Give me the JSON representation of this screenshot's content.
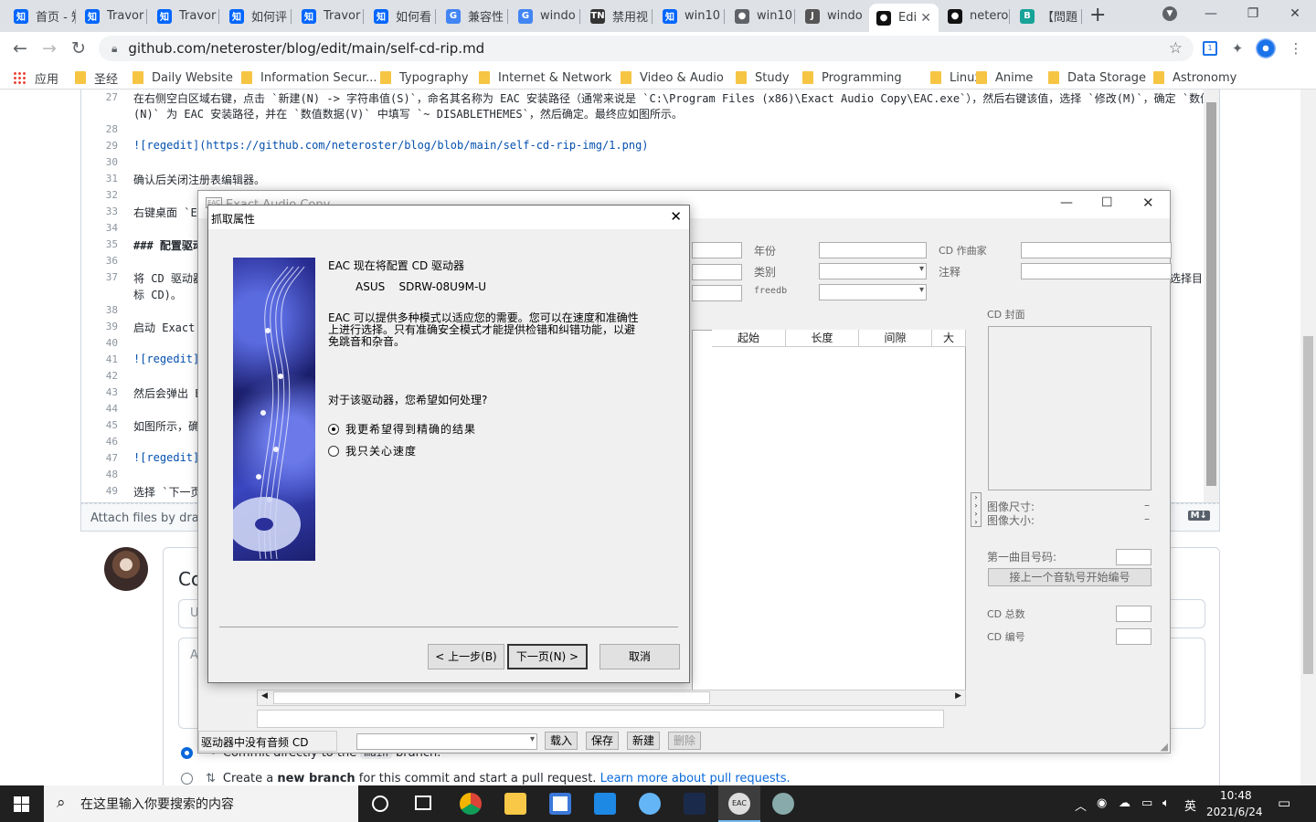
{
  "browser": {
    "tabs": [
      {
        "label": "首页 - 知",
        "favicon": "知",
        "color": "#0066ff"
      },
      {
        "label": "Travor",
        "favicon": "知",
        "color": "#0066ff"
      },
      {
        "label": "Travor",
        "favicon": "知",
        "color": "#0066ff"
      },
      {
        "label": "如何评",
        "favicon": "知",
        "color": "#0066ff"
      },
      {
        "label": "Travor",
        "favicon": "知",
        "color": "#0066ff"
      },
      {
        "label": "如何看",
        "favicon": "知",
        "color": "#0066ff"
      },
      {
        "label": "兼容性",
        "favicon": "G",
        "color": "#4285f4"
      },
      {
        "label": "windo",
        "favicon": "G",
        "color": "#4285f4"
      },
      {
        "label": "禁用视",
        "favicon": "TN",
        "color": "#333"
      },
      {
        "label": "win10",
        "favicon": "知",
        "color": "#0066ff"
      },
      {
        "label": "win10",
        "favicon": "●",
        "color": "#5f6368"
      },
      {
        "label": "windo",
        "favicon": "J",
        "color": "#555"
      },
      {
        "label": "Edi",
        "favicon": "●",
        "color": "#111"
      },
      {
        "label": "netero",
        "favicon": "●",
        "color": "#111"
      },
      {
        "label": "【問題",
        "favicon": "B",
        "color": "#17a398"
      }
    ],
    "active_tab_close": "✕",
    "new_tab": "+",
    "url": "github.com/neteroster/blog/edit/main/self-cd-rip.md",
    "window_controls": {
      "minimize": "—",
      "restore": "❐",
      "close": "✕"
    },
    "bookmarks": [
      {
        "label": "应用",
        "type": "apps"
      },
      {
        "label": "圣经"
      },
      {
        "label": "Daily Website"
      },
      {
        "label": "Information Secur..."
      },
      {
        "label": "Typography"
      },
      {
        "label": "Internet & Network"
      },
      {
        "label": "Video & Audio"
      },
      {
        "label": "Study"
      },
      {
        "label": "Programming"
      },
      {
        "label": "Linux"
      },
      {
        "label": "Anime"
      },
      {
        "label": "Data Storage"
      },
      {
        "label": "Astronomy"
      }
    ]
  },
  "editor": {
    "lines": [
      {
        "n": "27",
        "text": "在右侧空白区域右键，点击 `新建(N) -> 字符串值(S)`，命名其名称为 EAC 安装路径（通常来说是 `C:\\Program Files (x86)\\Exact Audio Copy\\EAC.exe`），然后右键该值，选择 `修改(M)`，确定 `数值名称"
      },
      {
        "n": "",
        "text": "(N)` 为 EAC 安装路径，并在 `数值数据(V)` 中填写 `~ DISABLETHEMES`，然后确定。最终应如图所示。"
      },
      {
        "n": "28",
        "text": ""
      },
      {
        "n": "29",
        "text": "![regedit](https://github.com/neteroster/blog/blob/main/self-cd-rip-img/1.png)"
      },
      {
        "n": "30",
        "text": ""
      },
      {
        "n": "31",
        "text": "确认后关闭注册表编辑器。"
      },
      {
        "n": "32",
        "text": ""
      },
      {
        "n": "33",
        "text": "右键桌面 `E"
      },
      {
        "n": "34",
        "text": ""
      },
      {
        "n": "35",
        "text": "### 配置驱动器"
      },
      {
        "n": "36",
        "text": ""
      },
      {
        "n": "37",
        "text": "将 CD 驱动器"
      },
      {
        "n": "",
        "text": "标 CD)。"
      },
      {
        "n": "38",
        "text": ""
      },
      {
        "n": "39",
        "text": "启动 Exact"
      },
      {
        "n": "40",
        "text": ""
      },
      {
        "n": "41",
        "text": "![regedit]("
      },
      {
        "n": "42",
        "text": ""
      },
      {
        "n": "43",
        "text": "然后会弹出 E"
      },
      {
        "n": "44",
        "text": ""
      },
      {
        "n": "45",
        "text": "如图所示，确"
      },
      {
        "n": "46",
        "text": ""
      },
      {
        "n": "47",
        "text": "![regedit]("
      },
      {
        "n": "48",
        "text": ""
      },
      {
        "n": "49",
        "text": "选择 `下一页"
      }
    ],
    "right_overflow": "选择目",
    "attach_text": "Attach files by dragg",
    "md_icon": "M↓"
  },
  "commit": {
    "title": "Co",
    "field1": "U",
    "field2": "A",
    "option1": {
      "prefix": "Commit directly to the",
      "branch": "main",
      "suffix": "branch."
    },
    "option2": {
      "prefix": "Create a",
      "bold": "new branch",
      "middle": "for this commit and start a pull request.",
      "link": "Learn more about pull requests."
    }
  },
  "eac": {
    "title": "Exact Audio Copy",
    "icon_text": "EAC",
    "labels": {
      "year": "年份",
      "composer": "CD 作曲家",
      "genre": "类别",
      "comment": "注释",
      "freedb": "freedb"
    },
    "columns": [
      "起始",
      "长度",
      "间隙",
      "大"
    ],
    "cover": {
      "title": "CD 封面",
      "size": "图像尺寸:",
      "filesize": "图像大小:",
      "size_val": "–",
      "filesize_val": "–"
    },
    "first_track_label": "第一曲目号码:",
    "continue_button": "接上一个音轨号开始编号",
    "total_label": "CD 总数",
    "number_label": "CD 编号",
    "status": "驱动器中没有音频 CD",
    "buttons": {
      "load": "载入",
      "save": "保存",
      "new": "新建",
      "delete": "删除"
    }
  },
  "dialog": {
    "title": "抓取属性",
    "close": "✕",
    "heading": "EAC 现在将配置 CD 驱动器",
    "drive": "ASUS    SDRW-08U9M-U",
    "desc1": "EAC 可以提供多种模式以适应您的需要。您可以在速度和准确性",
    "desc2": "上进行选择。只有准确安全模式才能提供检错和纠错功能，以避",
    "desc3": "免跳音和杂音。",
    "question": "对于该驱动器，您希望如何处理?",
    "option_accurate": "我更希望得到精确的结果",
    "option_speed": "我只关心速度",
    "selected": "accurate",
    "back_button": "< 上一步(B)",
    "next_button": "下一页(N) >",
    "cancel_button": "取消"
  },
  "taskbar": {
    "search_placeholder": "在这里输入你要搜索的内容",
    "tray": {
      "ime": "英",
      "time": "10:48",
      "date": "2021/6/24"
    }
  }
}
